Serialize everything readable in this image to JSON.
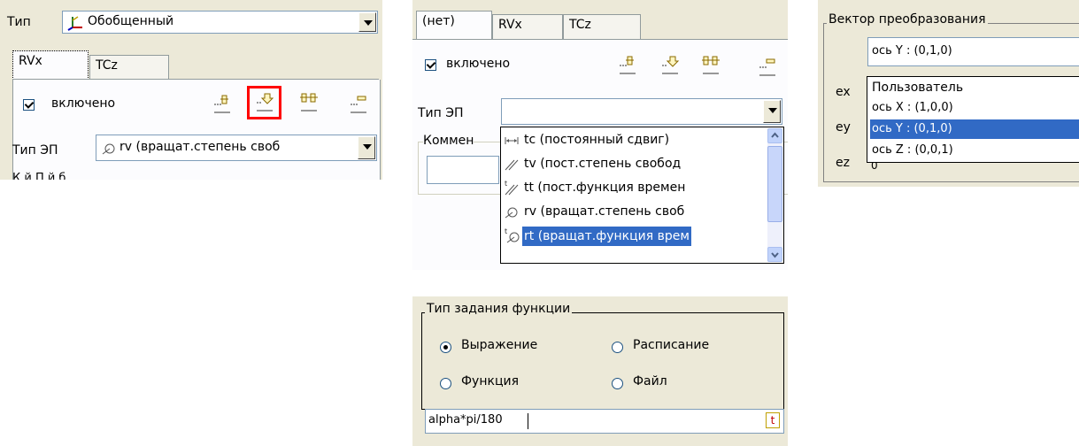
{
  "panel1": {
    "type_label": "Тип",
    "type_value": "Обобщенный",
    "tabs": [
      "RVx",
      "TCz"
    ],
    "enabled_label": "включено",
    "ep_label": "Тип ЭП",
    "ep_value": "rv (вращат.степень своб",
    "clipped_text": "К                 й П                й                б"
  },
  "panel2": {
    "tabs": [
      "(нет)",
      "RVx",
      "TCz"
    ],
    "enabled_label": "включено",
    "ep_label": "Тип ЭП",
    "comment_label": "Коммен",
    "ep_options": [
      {
        "prefix": "tc",
        "label": "tc (постоянный сдвиг)"
      },
      {
        "prefix": "tv",
        "label": "tv (пост.степень свобод"
      },
      {
        "prefix": "tt",
        "label": "tt (пост.функция времен"
      },
      {
        "prefix": "rv",
        "label": "rv (вращат.степень своб"
      },
      {
        "prefix": "rt",
        "label": "rt (вращат.функция врем"
      }
    ],
    "selected_index": 4
  },
  "panel3": {
    "group_title": "Вектор преобразования",
    "combo_value": "ось Y : (0,1,0)",
    "row_labels": [
      "ex",
      "ey",
      "ez"
    ],
    "options": [
      "Пользователь",
      "ось X : (1,0,0)",
      "ось Y : (0,1,0)",
      "ось Z : (0,0,1)"
    ],
    "selected_index": 2,
    "ez_value_fragment": "0"
  },
  "panel4": {
    "group_title": "Тип задания функции",
    "radios": [
      "Выражение",
      "Расписание",
      "Функция",
      "Файл"
    ],
    "selected_radio": 0,
    "expression": "alpha*pi/180",
    "t_button": "t"
  },
  "colors": {
    "dialog_bg": "#ece9d8",
    "selection": "#316ac5",
    "highlight_border": "#ff0000"
  }
}
